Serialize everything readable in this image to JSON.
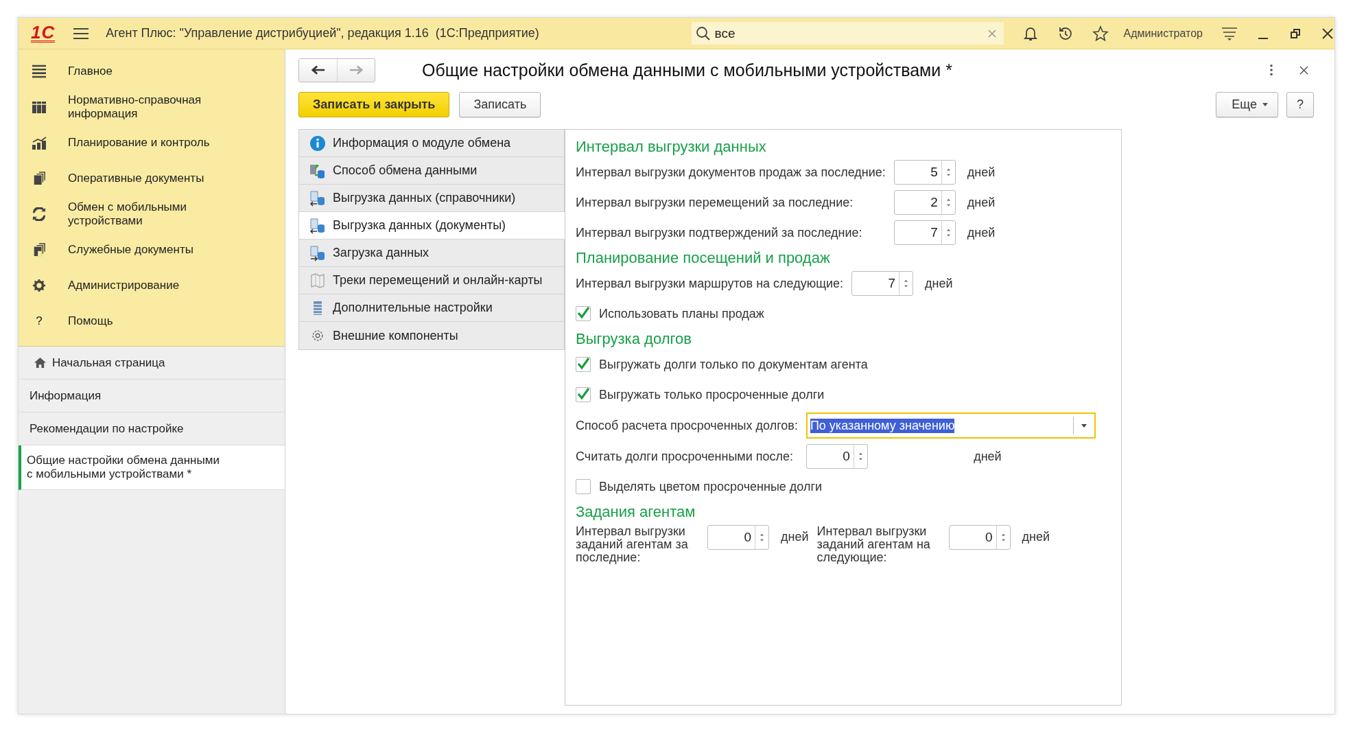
{
  "title_bar": {
    "logo": "1С",
    "title": "Агент Плюс: \"Управление дистрибуцией\", редакция 1.16  (1С:Предприятие)",
    "search": {
      "value": "все"
    },
    "user": "Администратор"
  },
  "sidebar": {
    "sections": [
      {
        "label": "Главное"
      },
      {
        "label": "Нормативно-справочная информация"
      },
      {
        "label": "Планирование и контроль"
      },
      {
        "label": "Оперативные документы"
      },
      {
        "label": "Обмен с мобильными устройствами"
      },
      {
        "label": "Служебные документы"
      },
      {
        "label": "Администрирование"
      },
      {
        "label": "Помощь",
        "glyph": "?"
      }
    ],
    "open_windows": [
      {
        "label": "Начальная страница",
        "selected": false
      },
      {
        "label": "Информация",
        "selected": false
      },
      {
        "label": "Рекомендации по настройке",
        "selected": false
      },
      {
        "label": "Общие настройки обмена данными с мобильными устройствами *",
        "selected": true
      }
    ]
  },
  "form": {
    "title": "Общие настройки обмена данными с мобильными устройствами *",
    "nav": {
      "back_disabled": false,
      "forward_disabled": true
    },
    "buttons": [
      {
        "label": "Записать и закрыть",
        "kind": "primary"
      },
      {
        "label": "Записать",
        "kind": "default"
      }
    ],
    "more_button": "Еще",
    "help_button": "?",
    "pages": [
      {
        "label": "Информация о модуле обмена",
        "selected": false
      },
      {
        "label": "Способ обмена данными",
        "selected": false
      },
      {
        "label": "Выгрузка данных (справочники)",
        "selected": false
      },
      {
        "label": "Выгрузка данных (документы)",
        "selected": true
      },
      {
        "label": "Загрузка данных",
        "selected": false
      },
      {
        "label": "Треки перемещений и онлайн-карты",
        "selected": false
      },
      {
        "label": "Дополнительные настройки",
        "selected": false
      },
      {
        "label": "Внешние компоненты",
        "selected": false
      }
    ],
    "sections": [
      {
        "title": "Интервал выгрузки данных",
        "rows": [
          {
            "kind": "number",
            "label": "Интервал выгрузки документов продаж за последние:",
            "value": "5",
            "unit": "дней"
          },
          {
            "kind": "number",
            "label": "Интервал выгрузки перемещений за последние:",
            "value": "2",
            "unit": "дней"
          },
          {
            "kind": "number",
            "label": "Интервал выгрузки подтверждений за последние:",
            "value": "7",
            "unit": "дней"
          }
        ]
      },
      {
        "title": "Планирование посещений и продаж",
        "rows": [
          {
            "kind": "number",
            "label": "Интервал выгрузки маршрутов на следующие:",
            "value": "7",
            "unit": "дней"
          },
          {
            "kind": "checkbox",
            "label": "Использовать планы продаж",
            "checked": true
          }
        ]
      },
      {
        "title": "Выгрузка долгов",
        "rows": [
          {
            "kind": "checkbox",
            "label": "Выгружать долги только по документам агента",
            "checked": true
          },
          {
            "kind": "checkbox",
            "label": "Выгружать только просроченные долги",
            "checked": true
          },
          {
            "kind": "select",
            "label": "Способ расчета просроченных долгов:",
            "value": "По указанному значению",
            "focused": true
          },
          {
            "kind": "number",
            "label": "Считать долги просроченными после:",
            "value": "0",
            "unit": "дней"
          },
          {
            "kind": "checkbox",
            "label": "Выделять цветом просроченные долги",
            "checked": false
          }
        ]
      },
      {
        "title": "Задания агентам",
        "rows": [
          {
            "kind": "pair",
            "fields": [
              {
                "label": "Интервал выгрузки заданий агентам за последние:",
                "value": "0",
                "unit": "дней"
              },
              {
                "label": "Интервал выгрузки заданий агентам на следующие:",
                "value": "0",
                "unit": "дней"
              }
            ]
          }
        ]
      }
    ]
  }
}
